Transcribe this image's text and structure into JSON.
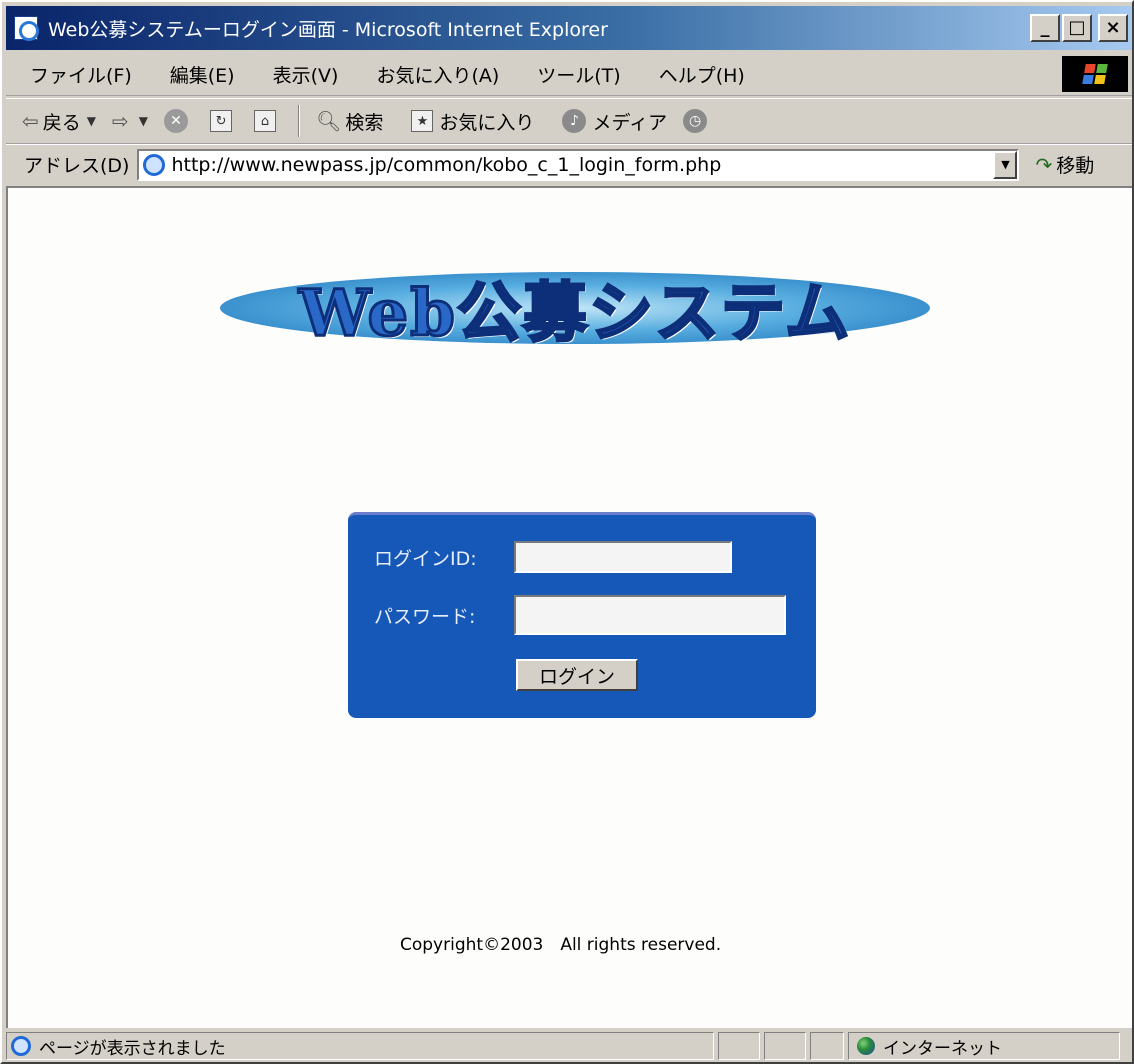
{
  "window": {
    "title": "Web公募システムーログイン画面 - Microsoft Internet Explorer",
    "buttons": {
      "minimize": "_",
      "maximize": "□",
      "close": "×"
    }
  },
  "menu": {
    "items": [
      "ファイル(F)",
      "編集(E)",
      "表示(V)",
      "お気に入り(A)",
      "ツール(T)",
      "ヘルプ(H)"
    ]
  },
  "toolbar": {
    "back": "戻る",
    "search": "検索",
    "favorites": "お気に入り",
    "media": "メディア"
  },
  "address": {
    "label": "アドレス(D)",
    "url": "http://www.newpass.jp/common/kobo_c_1_login_form.php",
    "go": "移動"
  },
  "page": {
    "logo_text": "Web公募システム",
    "login": {
      "id_label": "ログインID:",
      "id_value": "",
      "password_label": "パスワード:",
      "password_value": "",
      "button": "ログイン"
    },
    "copyright": "Copyright©2003　All rights reserved."
  },
  "status": {
    "text": "ページが表示されました",
    "zone": "インターネット"
  },
  "colors": {
    "titlebar": "#0a246a",
    "login_panel": "#1558b8",
    "chrome": "#d4d0c8"
  }
}
